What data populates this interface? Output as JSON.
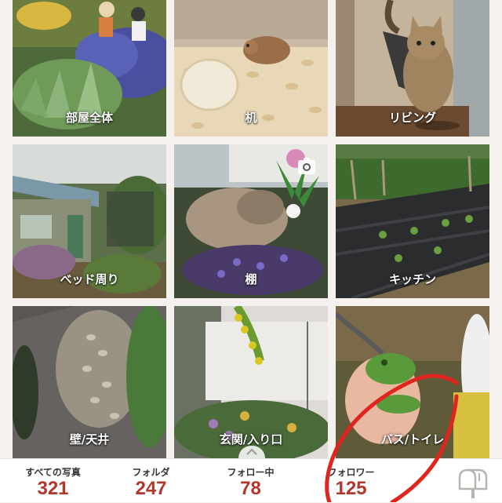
{
  "folders": [
    {
      "label": "部屋全体",
      "icon": "garden-photo"
    },
    {
      "label": "机",
      "icon": "mouse-photo"
    },
    {
      "label": "リビング",
      "icon": "cat-photo"
    },
    {
      "label": "ベッド周り",
      "icon": "shed-photo"
    },
    {
      "label": "棚",
      "icon": "rock-garden-photo"
    },
    {
      "label": "キッチン",
      "icon": "field-photo"
    },
    {
      "label": "壁/天井",
      "icon": "stone-path-photo"
    },
    {
      "label": "玄関/入り口",
      "icon": "entrance-garden-photo"
    },
    {
      "label": "バス/トイレ",
      "icon": "frog-photo"
    }
  ],
  "stats": {
    "all_photos": {
      "label": "すべての写真",
      "value": "321"
    },
    "folders": {
      "label": "フォルダ",
      "value": "247"
    },
    "following": {
      "label": "フォロー中",
      "value": "78"
    },
    "followers": {
      "label": "フォロワー",
      "value": "125"
    }
  },
  "colors": {
    "accent": "#b0372c",
    "background": "#f4f1ee",
    "annotation": "#e0251e"
  }
}
